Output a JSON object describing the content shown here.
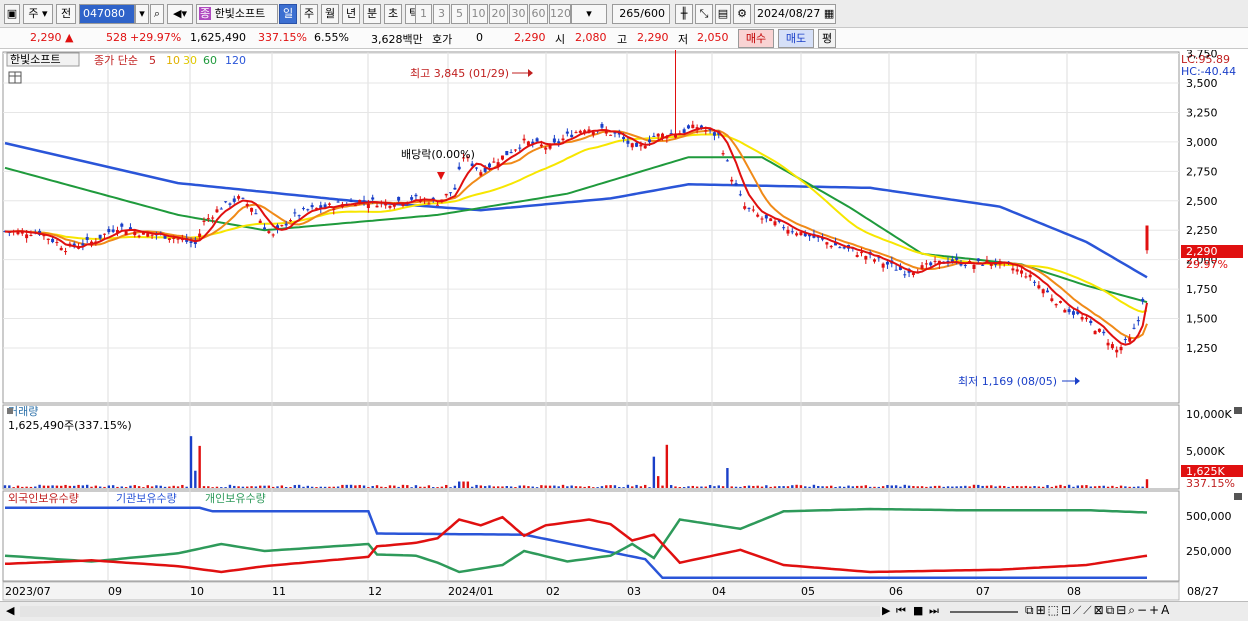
{
  "toolbar": {
    "period_unit": "주",
    "prev_label": "전",
    "stock_code": "047080",
    "badge": "종",
    "stock_name": "한빛소프트",
    "periods": [
      "일",
      "주",
      "월",
      "년",
      "분",
      "초",
      "틱"
    ],
    "selected_period": "일",
    "intervals": [
      "1",
      "3",
      "5",
      "10",
      "20",
      "30",
      "60",
      "120"
    ],
    "count": "265",
    "count_total": "/600",
    "date": "2024/08/27"
  },
  "quote": {
    "price": "2,290",
    "change": "528",
    "change_pct": "+29.97%",
    "volume": "1,625,490",
    "volume_ratio": "337.15%",
    "turnover": "6.55%",
    "amount": "3,628백만",
    "hoga_label": "호가",
    "hoga_value": "0",
    "hoga_price": "2,290",
    "open_label": "시",
    "open": "2,080",
    "high_label": "고",
    "high": "2,290",
    "low_label": "저",
    "low": "2,050",
    "buy_label": "매수",
    "sell_label": "매도",
    "eval_label": "평"
  },
  "price_panel": {
    "legend_name": "한빛소프트",
    "legend_ma_label": "종가 단순",
    "ma_periods": [
      "5",
      "10",
      "30",
      "60",
      "120"
    ],
    "lc_label": "LC:95.89",
    "hc_label": "HC:-40.44",
    "high_note": "최고 3,845 (01/29)",
    "low_note": "최저 1,169 (08/05)",
    "dividend_note": "배당락(0.00%)",
    "current_price_tag": "2,290",
    "current_pct_tag": "29.97%",
    "y_ticks": [
      "3,750",
      "3,500",
      "3,250",
      "3,000",
      "2,750",
      "2,500",
      "2,250",
      "2,000",
      "1,750",
      "1,500",
      "1,250"
    ]
  },
  "volume_panel": {
    "title": "거래량",
    "value_label": "1,625,490주(337.15%)",
    "y_ticks": [
      "10,000K",
      "5,000K"
    ],
    "current_tag": "1,625K",
    "current_pct": "337.15%"
  },
  "holder_panel": {
    "legend": [
      "외국인보유수량",
      "기관보유수량",
      "개인보유수량"
    ],
    "y_ticks": [
      "500,000",
      "250,000"
    ]
  },
  "x_axis": [
    "2023/07",
    "09",
    "10",
    "11",
    "12",
    "2024/01",
    "02",
    "03",
    "04",
    "05",
    "06",
    "07",
    "08",
    "08/27"
  ],
  "colors": {
    "candle_up": "#e01010",
    "candle_down": "#1a3fc8",
    "ma5": "#e01010",
    "ma10": "#f08a18",
    "ma30": "#f7e600",
    "ma60": "#1f9a3c",
    "ma120": "#2a55d8",
    "foreign": "#e01010",
    "institution": "#2a55d8",
    "individual": "#2e9a5a"
  },
  "chart_data": {
    "type": "candlestick",
    "title": "한빛소프트",
    "x_range": [
      "2023/07",
      "2024/08/27"
    ],
    "ylim": [
      1169,
      3845
    ],
    "series_summary": {
      "high": {
        "value": 3845,
        "date": "01/29"
      },
      "low": {
        "value": 1169,
        "date": "08/05"
      },
      "last": {
        "close": 2290,
        "open": 2080,
        "high": 2290,
        "low": 2050,
        "change_pct": 29.97
      },
      "ma120_last": 1850,
      "ma60_last": 1640
    },
    "volume_last": 1625490,
    "holders_ylim": [
      0,
      600000
    ]
  }
}
